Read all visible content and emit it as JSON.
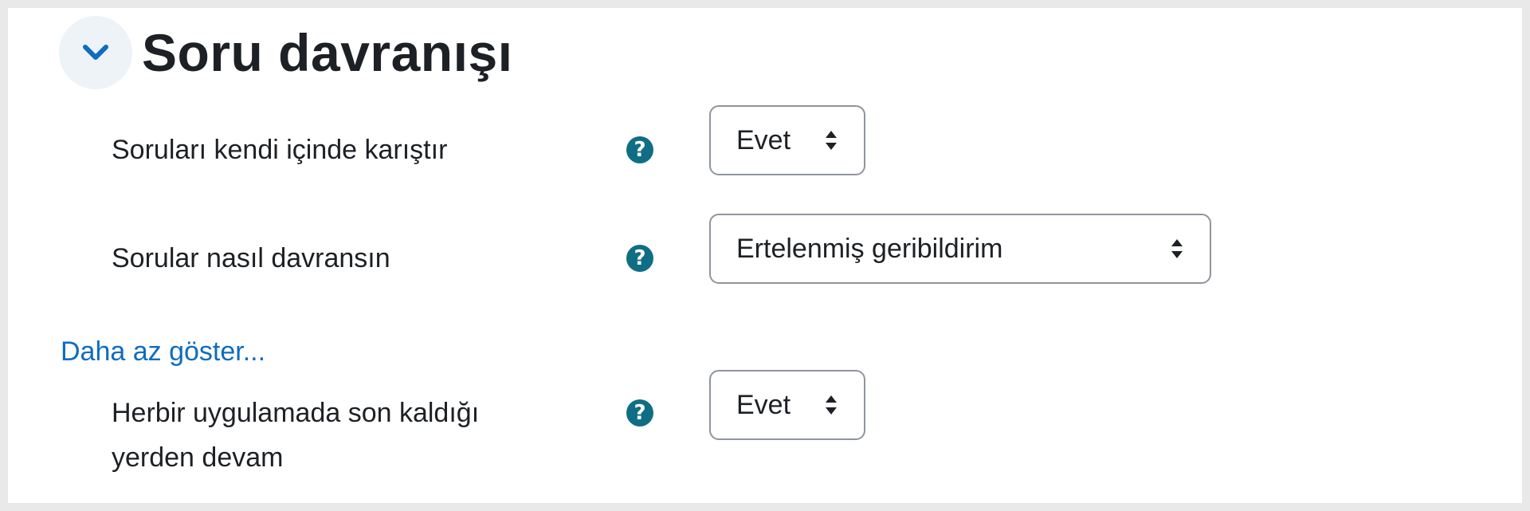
{
  "section": {
    "title": "Soru davranışı",
    "collapse_icon": "chevron-down-icon",
    "accent_color": "#0f6cbf"
  },
  "settings": [
    {
      "label": "Soruları kendi içinde karıştır",
      "help_icon": "question-circle-icon",
      "value": "Evet"
    },
    {
      "label": "Sorular nasıl davransın",
      "help_icon": "question-circle-icon",
      "value": "Ertelenmiş geribildirim"
    },
    {
      "label_line1": "Herbir uygulamada son kaldığı",
      "label_line2": "yerden devam",
      "help_icon": "question-circle-icon",
      "value": "Evet"
    }
  ],
  "show_less_link": "Daha az göster...",
  "help_icon_color": "#0f6e84",
  "help_glyph": "?"
}
